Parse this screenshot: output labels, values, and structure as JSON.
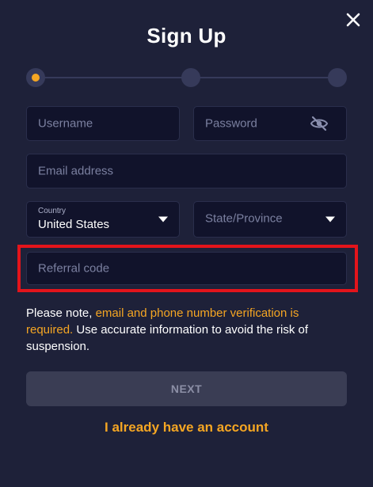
{
  "dialog": {
    "title": "Sign Up",
    "close_icon": "close-icon"
  },
  "stepper": {
    "steps": 3,
    "current_step": 1,
    "active_color": "#f5a623"
  },
  "form": {
    "username": {
      "placeholder": "Username"
    },
    "password": {
      "placeholder": "Password",
      "icon": "eye-slash-icon"
    },
    "email": {
      "placeholder": "Email address"
    },
    "country": {
      "label": "Country",
      "value": "United States",
      "icon": "caret-down-icon"
    },
    "state": {
      "placeholder": "State/Province",
      "icon": "caret-down-icon"
    },
    "referral": {
      "placeholder": "Referral code",
      "highlight_color": "#e3141b"
    }
  },
  "notice": {
    "prefix": "Please note, ",
    "highlight": "email and phone number verification is required.",
    "suffix": " Use accurate information to avoid the risk of suspension."
  },
  "actions": {
    "next_label": "NEXT",
    "login_link": "I already have an account"
  },
  "colors": {
    "background": "#1e2139",
    "field": "#11132b",
    "accent": "#f5a623"
  }
}
